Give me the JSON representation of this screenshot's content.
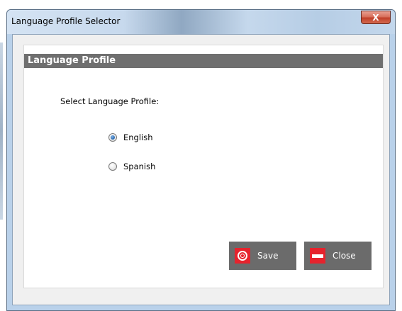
{
  "window": {
    "title": "Language Profile Selector",
    "close_glyph": "X"
  },
  "panel": {
    "header": "Language Profile",
    "prompt": "Select Language Profile:"
  },
  "options": [
    {
      "label": "English",
      "selected": true
    },
    {
      "label": "Spanish",
      "selected": false
    }
  ],
  "buttons": {
    "save_label": "Save",
    "close_label": "Close"
  },
  "icons": {
    "save": "target-icon",
    "close": "minus-icon"
  },
  "colors": {
    "header_bg": "#6f6f6f",
    "button_bg": "#6b6b6b",
    "icon_red": "#e6232d"
  }
}
